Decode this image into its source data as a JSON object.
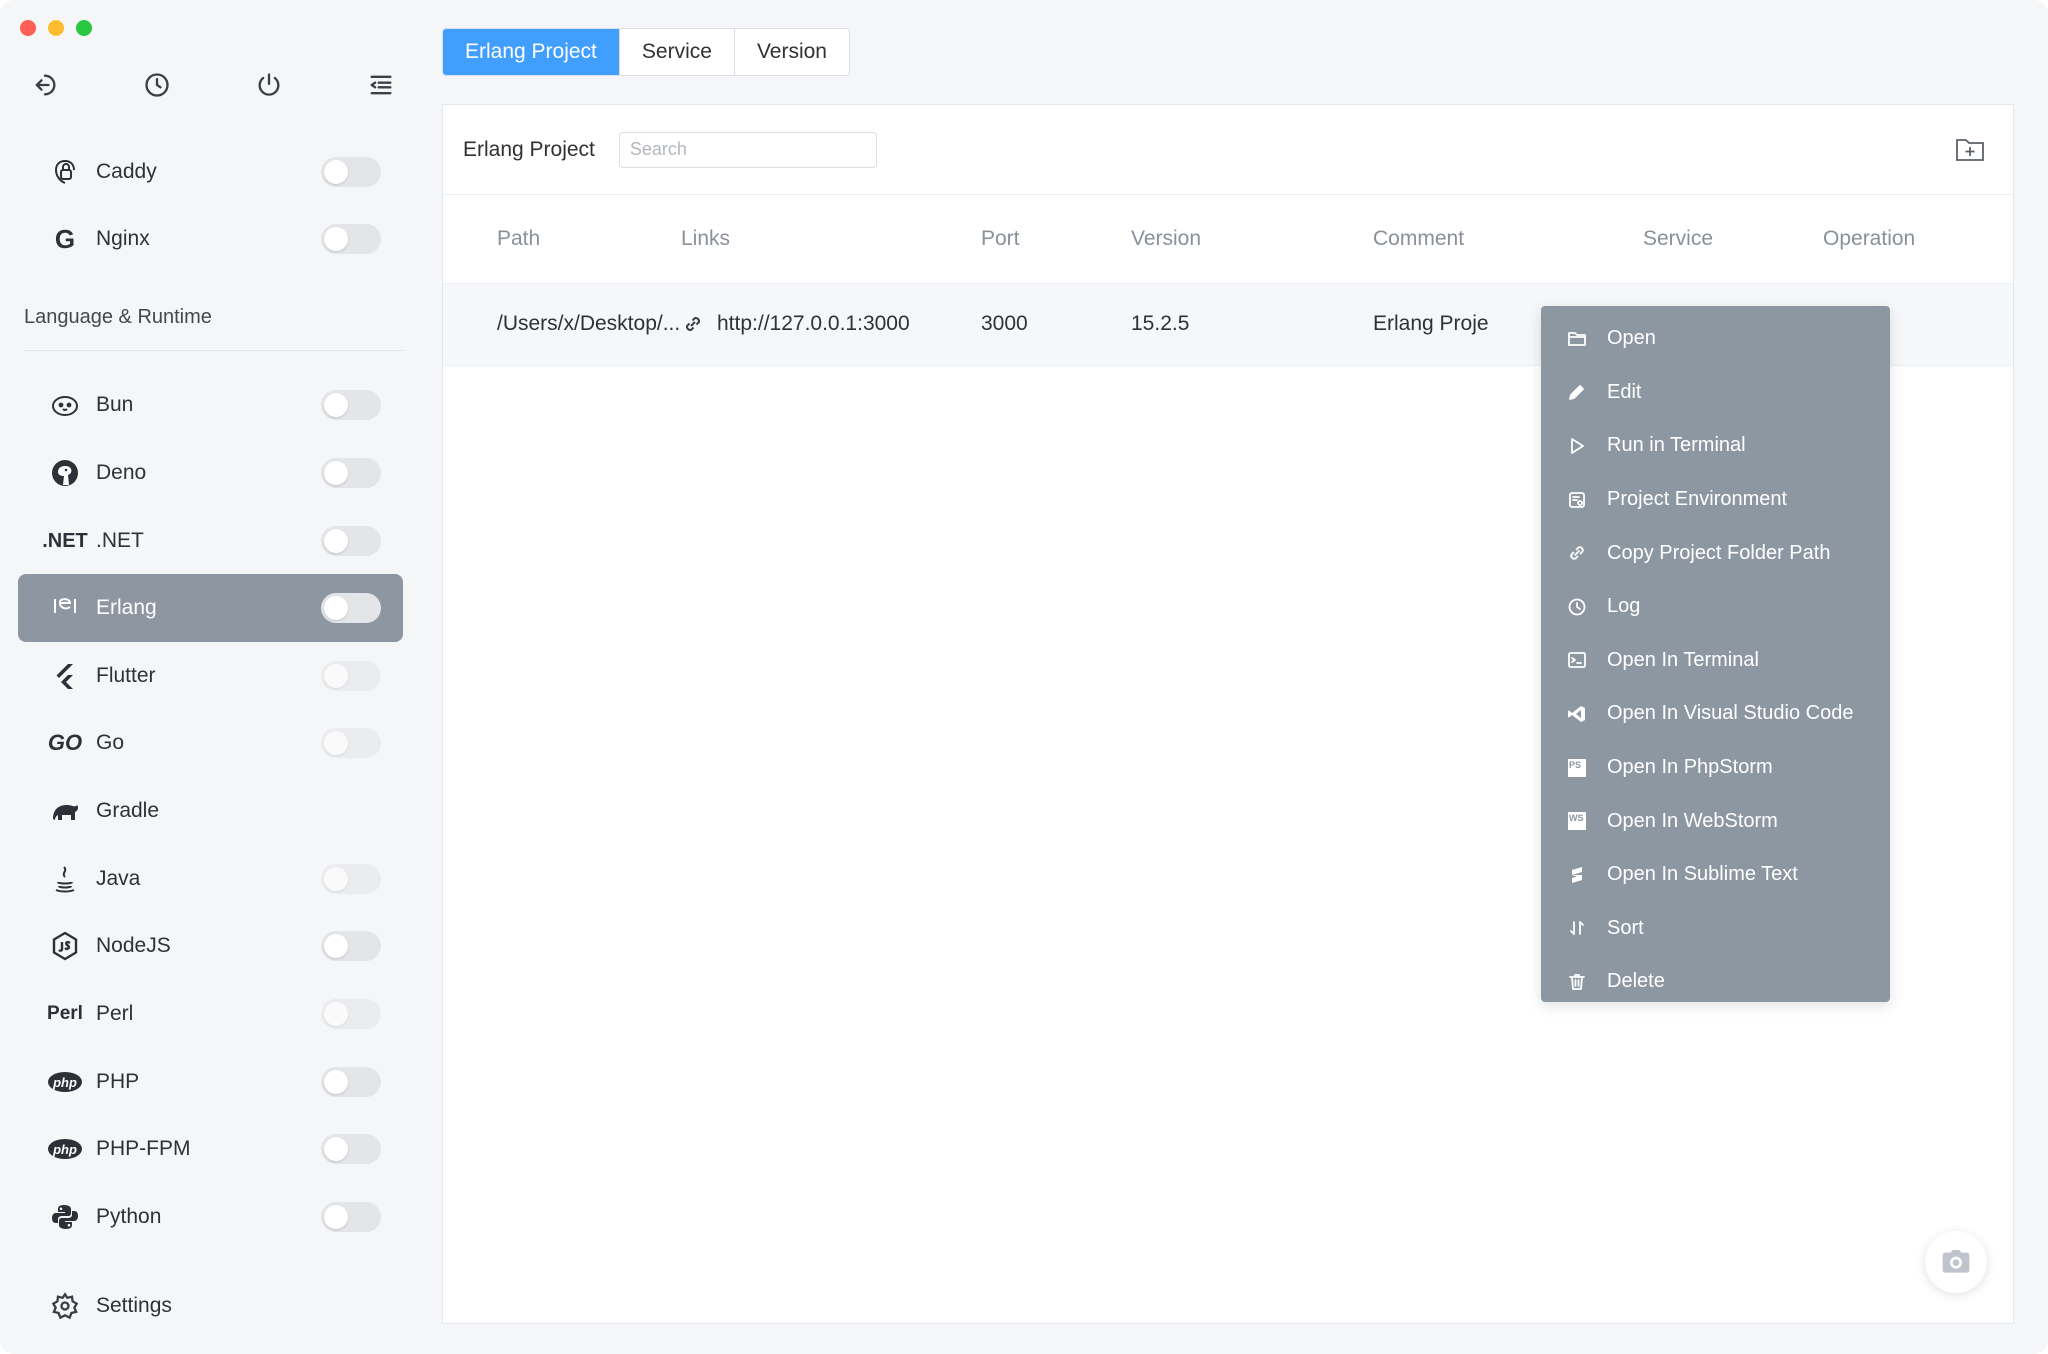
{
  "window": {
    "traffic_lights": [
      "close",
      "minimize",
      "zoom"
    ]
  },
  "sidebar": {
    "top_icons": [
      "back-icon",
      "history-icon",
      "power-icon",
      "menu-collapse-icon"
    ],
    "web_servers": [
      {
        "label": "Caddy",
        "icon": "caddy-icon",
        "glyph": ""
      },
      {
        "label": "Nginx",
        "icon": "nginx-icon",
        "glyph": "G"
      }
    ],
    "section_title": "Language & Runtime",
    "items": [
      {
        "label": "Bun",
        "icon": "bun-icon",
        "glyph": ""
      },
      {
        "label": "Deno",
        "icon": "deno-icon",
        "glyph": ""
      },
      {
        "label": ".NET",
        "icon": "dotnet-icon",
        "glyph": ".NET"
      },
      {
        "label": "Erlang",
        "icon": "erlang-icon",
        "glyph": ""
      },
      {
        "label": "Flutter",
        "icon": "flutter-icon",
        "glyph": ""
      },
      {
        "label": "Go",
        "icon": "go-icon",
        "glyph": "GO"
      },
      {
        "label": "Gradle",
        "icon": "gradle-icon",
        "glyph": ""
      },
      {
        "label": "Java",
        "icon": "java-icon",
        "glyph": ""
      },
      {
        "label": "NodeJS",
        "icon": "nodejs-icon",
        "glyph": ""
      },
      {
        "label": "Perl",
        "icon": "perl-icon",
        "glyph": "Perl"
      },
      {
        "label": "PHP",
        "icon": "php-icon",
        "glyph": "php"
      },
      {
        "label": "PHP-FPM",
        "icon": "php-icon",
        "glyph": "php"
      },
      {
        "label": "Python",
        "icon": "python-icon",
        "glyph": ""
      }
    ],
    "settings_label": "Settings"
  },
  "tabs": [
    {
      "label": "Erlang Project",
      "active": true
    },
    {
      "label": "Service",
      "active": false
    },
    {
      "label": "Version",
      "active": false
    }
  ],
  "panel": {
    "title": "Erlang Project",
    "search_placeholder": "Search",
    "columns": [
      "Path",
      "Links",
      "Port",
      "Version",
      "Comment",
      "Service",
      "Operation"
    ],
    "rows": [
      {
        "path": "/Users/x/Desktop/...",
        "link": "http://127.0.0.1:3000",
        "port": "3000",
        "version": "15.2.5",
        "comment": "Erlang Proje"
      }
    ]
  },
  "context_menu": {
    "items": [
      {
        "label": "Open",
        "icon": "folder-icon"
      },
      {
        "label": "Edit",
        "icon": "pencil-icon"
      },
      {
        "label": "Run in Terminal",
        "icon": "play-icon"
      },
      {
        "label": "Project Environment",
        "icon": "environment-icon"
      },
      {
        "label": "Copy Project Folder Path",
        "icon": "copy-icon"
      },
      {
        "label": "Log",
        "icon": "clock-icon"
      },
      {
        "label": "Open In Terminal",
        "icon": "terminal-icon"
      },
      {
        "label": "Open In Visual Studio Code",
        "icon": "vscode-icon"
      },
      {
        "label": "Open In PhpStorm",
        "icon": "phpstorm-icon",
        "badge": "PS"
      },
      {
        "label": "Open In WebStorm",
        "icon": "webstorm-icon",
        "badge": "WS"
      },
      {
        "label": "Open In Sublime Text",
        "icon": "sublime-icon"
      },
      {
        "label": "Sort",
        "icon": "sort-icon"
      },
      {
        "label": "Delete",
        "icon": "trash-icon"
      }
    ]
  },
  "colors": {
    "accent": "#409eff",
    "active_item_bg": "#8d96a1",
    "menu_bg": "#8d97a2",
    "operation_dots": "#e6a23c"
  }
}
